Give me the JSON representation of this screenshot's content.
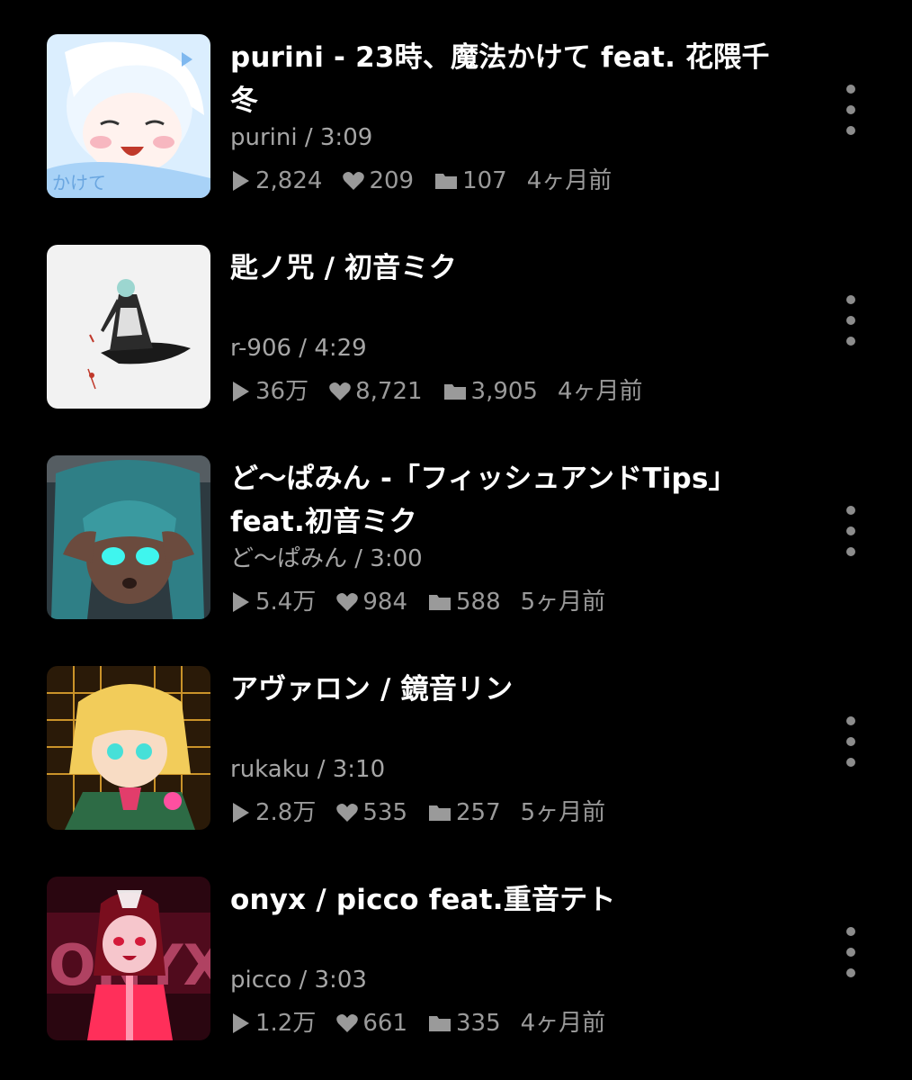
{
  "items": [
    {
      "title": "purini - 23時、魔法かけて feat. 花隈千冬",
      "meta": "purini / 3:09",
      "plays": "2,824",
      "likes": "209",
      "mylists": "107",
      "posted": "4ヶ月前",
      "thumb_text": "かけて"
    },
    {
      "title": "匙ノ咒 / 初音ミク",
      "meta": "r-906 / 4:29",
      "plays": "36万",
      "likes": "8,721",
      "mylists": "3,905",
      "posted": "4ヶ月前"
    },
    {
      "title": "ど〜ぱみん -「フィッシュアンドTips」feat.初音ミク",
      "meta": "ど〜ぱみん / 3:00",
      "plays": "5.4万",
      "likes": "984",
      "mylists": "588",
      "posted": "5ヶ月前"
    },
    {
      "title": "アヴァロン / 鏡音リン",
      "meta": "rukaku / 3:10",
      "plays": "2.8万",
      "likes": "535",
      "mylists": "257",
      "posted": "5ヶ月前"
    },
    {
      "title": "onyx / picco feat.重音テト",
      "meta": "picco / 3:03",
      "plays": "1.2万",
      "likes": "661",
      "mylists": "335",
      "posted": "4ヶ月前",
      "thumb_text": "ONYX"
    }
  ],
  "icons": {
    "play": "play-icon",
    "like": "heart-icon",
    "mylist": "folder-icon",
    "more": "more-vertical-icon"
  },
  "colors": {
    "background": "#000000",
    "title": "#ffffff",
    "meta": "#a6a6a6",
    "stats": "#9a9a9a"
  }
}
